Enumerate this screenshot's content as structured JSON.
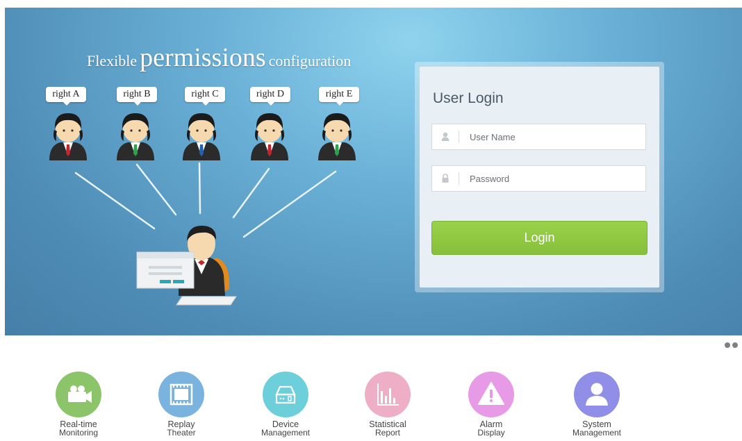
{
  "banner": {
    "headline": {
      "part1": "Flexible",
      "part2": "permissions",
      "part3": "configuration"
    },
    "rights": [
      "right A",
      "right B",
      "right C",
      "right D",
      "right E"
    ],
    "tie_colors": [
      "#c0262a",
      "#2aa34a",
      "#1f62b5",
      "#c0262a",
      "#2aa34a"
    ]
  },
  "login": {
    "title": "User Login",
    "username_placeholder": "User Name",
    "password_placeholder": "Password",
    "button_label": "Login",
    "button_color": "#8cc63f"
  },
  "carousel": {
    "dots": 2
  },
  "nav": [
    {
      "line1": "Real-time",
      "line2": "Monitoring",
      "color": "#8cc46a",
      "icon": "camera-icon"
    },
    {
      "line1": "Replay",
      "line2": "Theater",
      "color": "#79b3de",
      "icon": "film-icon"
    },
    {
      "line1": "Device",
      "line2": "Management",
      "color": "#6dcfd9",
      "icon": "device-icon"
    },
    {
      "line1": "Statistical",
      "line2": "Report",
      "color": "#eeaec6",
      "icon": "bar-chart-icon"
    },
    {
      "line1": "Alarm",
      "line2": "Display",
      "color": "#e79ae6",
      "icon": "warning-icon"
    },
    {
      "line1": "System",
      "line2": "Management",
      "color": "#908ee6",
      "icon": "user-icon"
    }
  ]
}
